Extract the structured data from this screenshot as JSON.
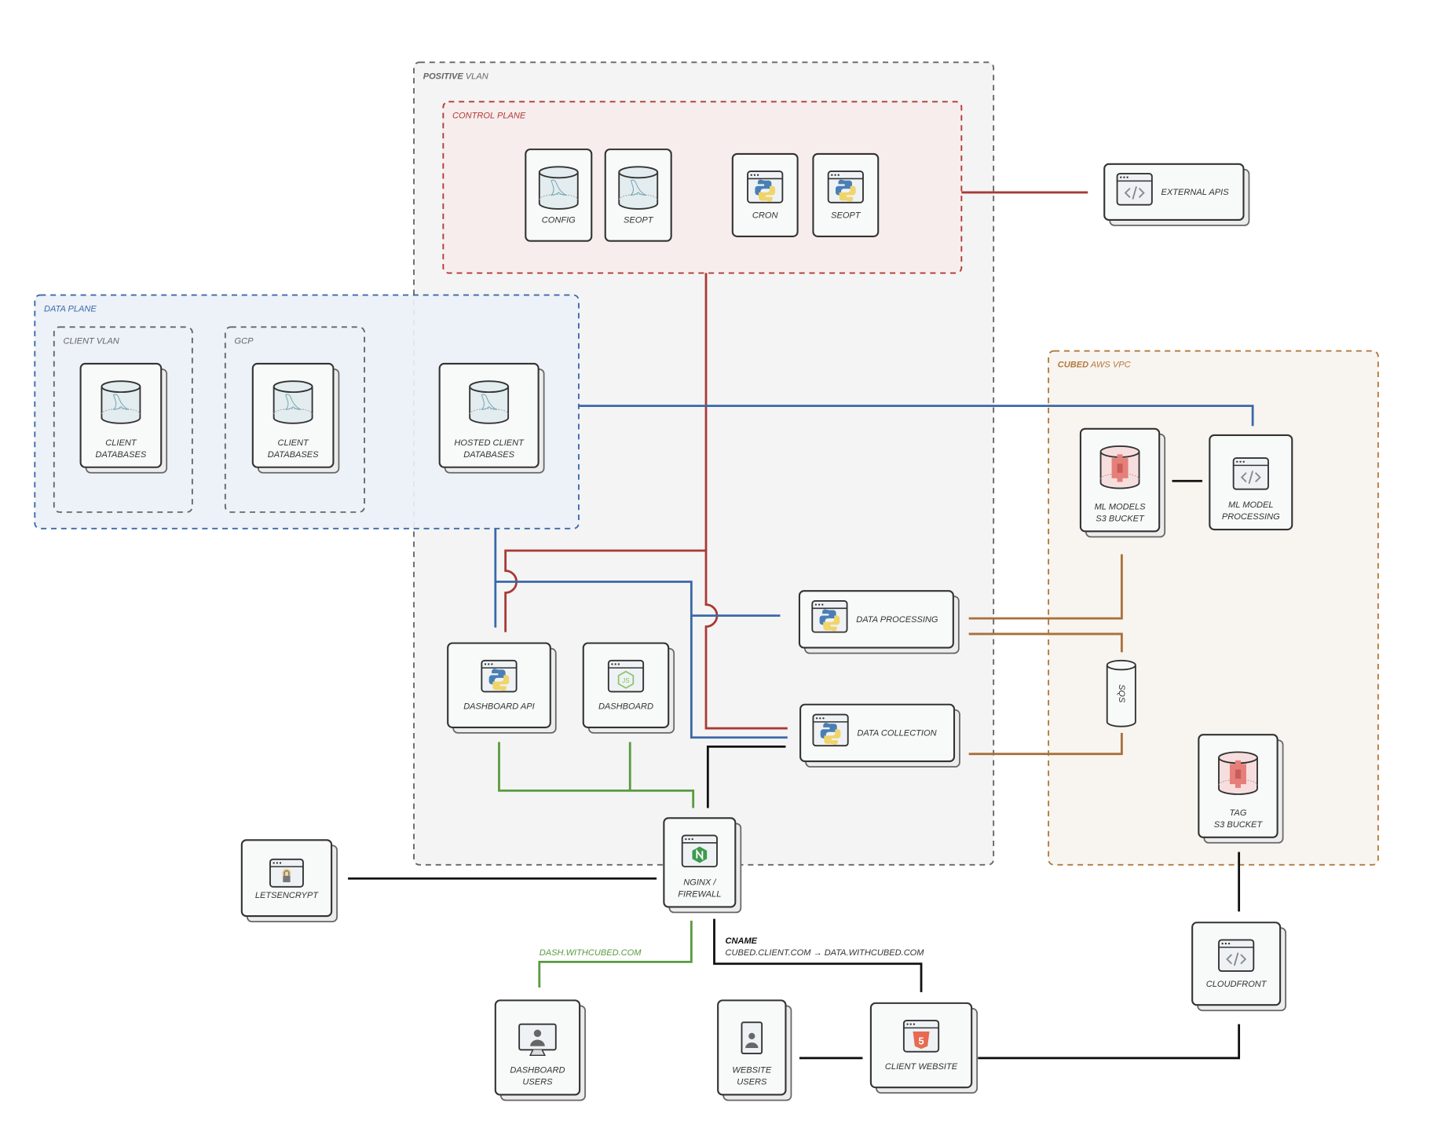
{
  "groups": {
    "positive_vlan": {
      "bold": "POSITIVE",
      "rest": " VLAN",
      "color": "#666666"
    },
    "control_plane": {
      "bold": "",
      "rest": "CONTROL PLANE",
      "color": "#b03a36"
    },
    "data_plane": {
      "bold": "",
      "rest": "DATA PLANE",
      "color": "#3a6aa8"
    },
    "client_vlan": {
      "bold": "",
      "rest": "CLIENT VLAN",
      "color": "#666666"
    },
    "gcp": {
      "bold": "",
      "rest": "GCP",
      "color": "#666666"
    },
    "cubed_aws_vpc": {
      "bold": "CUBED",
      "rest": " AWS VPC",
      "color": "#b07a40"
    }
  },
  "nodes": {
    "config": {
      "label": [
        "CONFIG"
      ],
      "icon": "mysql-database"
    },
    "seopt_db": {
      "label": [
        "SEOPT"
      ],
      "icon": "mysql-database"
    },
    "cron": {
      "label": [
        "CRON"
      ],
      "icon": "python-window"
    },
    "seopt_py": {
      "label": [
        "SEOPT"
      ],
      "icon": "python-window"
    },
    "external_apis": {
      "label": [
        "EXTERNAL APIS"
      ],
      "icon": "code-window"
    },
    "client_db_vlan": {
      "label": [
        "CLIENT",
        "DATABASES"
      ],
      "icon": "mysql-database"
    },
    "client_db_gcp": {
      "label": [
        "CLIENT",
        "DATABASES"
      ],
      "icon": "mysql-database"
    },
    "hosted_client_db": {
      "label": [
        "HOSTED CLIENT",
        "DATABASES"
      ],
      "icon": "mysql-database"
    },
    "ml_models_s3": {
      "label": [
        "ML MODELS",
        "S3 BUCKET"
      ],
      "icon": "s3-bucket"
    },
    "ml_model_processing": {
      "label": [
        "ML MODEL",
        "PROCESSING"
      ],
      "icon": "code-window"
    },
    "data_processing": {
      "label": [
        "DATA PROCESSING"
      ],
      "icon": "python-window"
    },
    "data_collection": {
      "label": [
        "DATA COLLECTION"
      ],
      "icon": "python-window"
    },
    "dashboard_api": {
      "label": [
        "DASHBOARD API"
      ],
      "icon": "python-window"
    },
    "dashboard": {
      "label": [
        "DASHBOARD"
      ],
      "icon": "nodejs-window"
    },
    "nginx": {
      "label": [
        "NGINX /",
        "FIREWALL"
      ],
      "icon": "nginx-window"
    },
    "letsencrypt": {
      "label": [
        "LETSENCRYPT"
      ],
      "icon": "lock-window"
    },
    "sqs": {
      "label": [
        "SQS"
      ],
      "icon": "queue-cylinder"
    },
    "tag_s3": {
      "label": [
        "TAG",
        "S3 BUCKET"
      ],
      "icon": "s3-bucket"
    },
    "cloudfront": {
      "label": [
        "CLOUDFRONT"
      ],
      "icon": "code-window"
    },
    "dashboard_users": {
      "label": [
        "DASHBOARD",
        "USERS"
      ],
      "icon": "monitor-user"
    },
    "website_users": {
      "label": [
        "WEBSITE",
        "USERS"
      ],
      "icon": "phone-user"
    },
    "client_website": {
      "label": [
        "CLIENT WEBSITE"
      ],
      "icon": "html5-window"
    }
  },
  "annotations": {
    "dash_domain": "DASH.WITHCUBED.COM",
    "cname_title": "CNAME",
    "cname_value": "CUBED.CLIENT.COM → DATA.WITHCUBED.COM"
  },
  "colors": {
    "control": "#a83a34",
    "data": "#3a68a8",
    "dashboard": "#5a9a40",
    "aws": "#a8703a",
    "public": "#111111"
  }
}
